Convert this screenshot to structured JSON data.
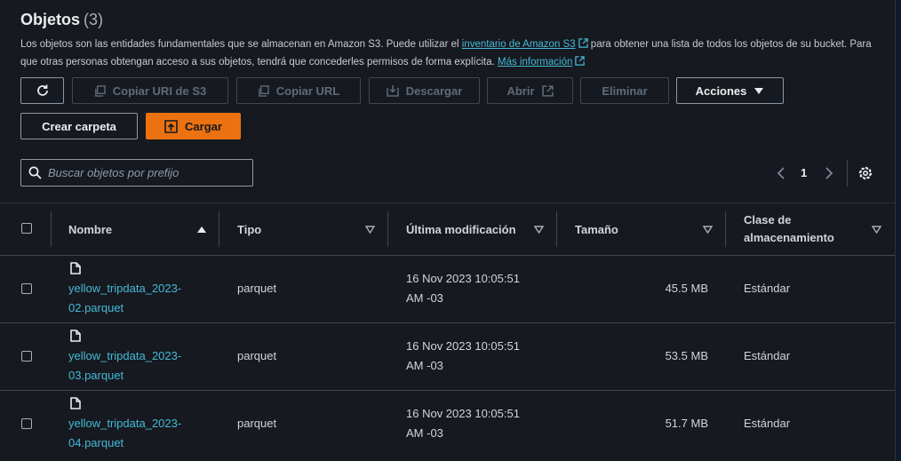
{
  "header": {
    "title": "Objetos",
    "count": "(3)",
    "description_pre": "Los objetos son las entidades fundamentales que se almacenan en Amazon S3. Puede utilizar el ",
    "inventory_link": "inventario de Amazon S3",
    "description_mid": " para obtener una lista de todos los objetos de su bucket. Para que otras personas obtengan acceso a sus objetos, tendrá que concederles permisos de forma explícita. ",
    "more_info_link": "Más información"
  },
  "toolbar": {
    "refresh_icon": "refresh-icon",
    "copy_uri": "Copiar URI de S3",
    "copy_url": "Copiar URL",
    "download": "Descargar",
    "open": "Abrir",
    "delete": "Eliminar",
    "actions": "Acciones",
    "create_folder": "Crear carpeta",
    "upload": "Cargar"
  },
  "search": {
    "placeholder": "Buscar objetos por prefijo",
    "value": ""
  },
  "pagination": {
    "page": "1"
  },
  "colors": {
    "accent": "#ec7211",
    "link": "#44b9d6",
    "background": "#16191f"
  },
  "table": {
    "columns": [
      "Nombre",
      "Tipo",
      "Última modificación",
      "Tamaño",
      "Clase de almacenamiento"
    ],
    "rows": [
      {
        "name_line1": "yellow_tripdata_2023-",
        "name_line2": "02.parquet",
        "type": "parquet",
        "modified_line1": "16 Nov 2023 10:05:51",
        "modified_line2": "AM -03",
        "size": "45.5 MB",
        "storage_class": "Estándar"
      },
      {
        "name_line1": "yellow_tripdata_2023-",
        "name_line2": "03.parquet",
        "type": "parquet",
        "modified_line1": "16 Nov 2023 10:05:51",
        "modified_line2": "AM -03",
        "size": "53.5 MB",
        "storage_class": "Estándar"
      },
      {
        "name_line1": "yellow_tripdata_2023-",
        "name_line2": "04.parquet",
        "type": "parquet",
        "modified_line1": "16 Nov 2023 10:05:51",
        "modified_line2": "AM -03",
        "size": "51.7 MB",
        "storage_class": "Estándar"
      }
    ]
  }
}
